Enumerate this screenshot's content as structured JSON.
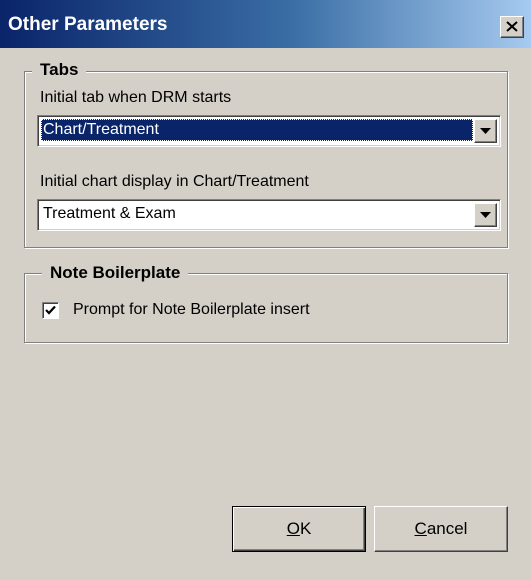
{
  "window": {
    "title": "Other Parameters",
    "close_glyph": "close-icon"
  },
  "tabs_group": {
    "legend": "Tabs",
    "initial_tab_label": "Initial tab when DRM starts",
    "initial_tab_value": "Chart/Treatment",
    "initial_chart_label": "Initial chart display in Chart/Treatment",
    "initial_chart_value": "Treatment & Exam"
  },
  "boilerplate_group": {
    "legend": "Note Boilerplate",
    "prompt_label": "Prompt for Note Boilerplate insert",
    "prompt_checked": true
  },
  "buttons": {
    "ok_mnemonic": "O",
    "ok_rest": "K",
    "cancel_mnemonic": "C",
    "cancel_rest": "ancel"
  },
  "colors": {
    "title_bar_start": "#0a246a",
    "title_bar_end": "#a6caf0",
    "selection": "#0a246a",
    "face": "#d4d0c8"
  }
}
